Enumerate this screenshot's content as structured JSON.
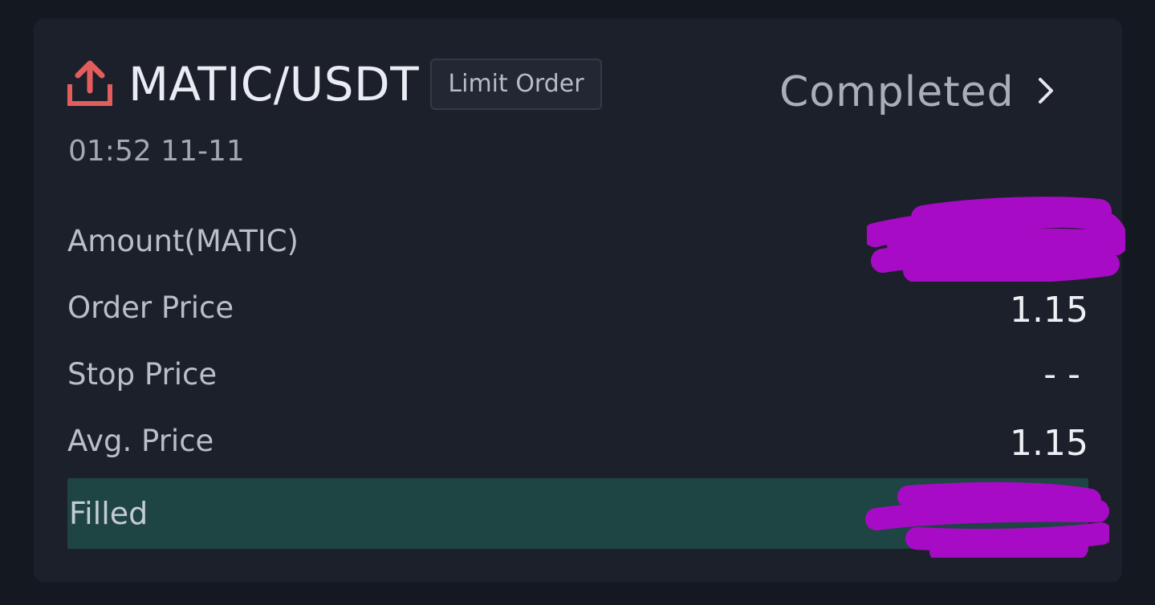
{
  "order": {
    "pair": "MATIC/USDT",
    "type": "Limit Order",
    "status": "Completed",
    "time": "01:52 11-11",
    "side_icon": "upload-icon",
    "side_color": "#e35d5d"
  },
  "rows": {
    "amount": {
      "label": "Amount(MATIC)",
      "value": ""
    },
    "order_price": {
      "label": "Order Price",
      "value": "1.15"
    },
    "stop_price": {
      "label": "Stop Price",
      "value": "- -"
    },
    "avg_price": {
      "label": "Avg. Price",
      "value": "1.15"
    }
  },
  "filled": {
    "label": "Filled",
    "progress_percent": 100,
    "bar_color": "#1f4444"
  },
  "redaction_color": "#a80bc6"
}
